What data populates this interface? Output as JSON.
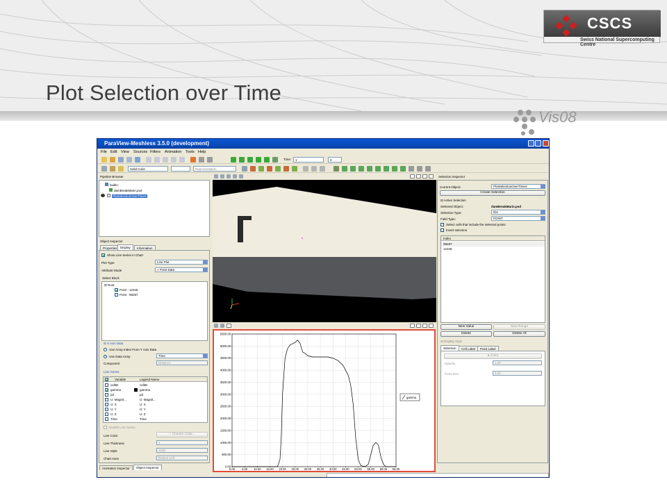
{
  "slide": {
    "title": "Plot Selection over Time",
    "logo_cscs": "CSCS",
    "logo_cscs_sub": "Swiss National Supercomputing Centre",
    "logo_vis": "Vis08"
  },
  "app": {
    "window_title": "ParaView-Meshless 3.5.0 (development)",
    "menu": [
      "File",
      "Edit",
      "View",
      "Sources",
      "Filters",
      "Animation",
      "Tools",
      "Help"
    ],
    "toolbar": {
      "time_label": "Time:",
      "time_value": "1",
      "time_index": "0",
      "color_by": "Solid Color",
      "representation": "Representation"
    },
    "pipeline_browser": {
      "title": "Pipeline Browser",
      "items": [
        "builtin:",
        "damBreakMarin.pvd",
        "PlotSelectionOverTimeX"
      ]
    },
    "object_inspector": {
      "title": "Object Inspector",
      "tabs": [
        "Properties",
        "Display",
        "Information"
      ],
      "show_line_series": "Show Line Series in Chart",
      "plot_type_label": "Plot Type",
      "plot_type_value": "Line Plot",
      "attribute_mode_label": "Attribute Mode",
      "attribute_mode_value": "Point Data",
      "select_block_label": "Select Block",
      "tree": [
        "Root",
        "Point : 12345",
        "Point : 98287"
      ],
      "x_axis_data": "X Axis Data",
      "use_array_index": "Use Array Index From Y Axis Data",
      "use_data_array": "Use Data Array",
      "data_array_value": "Time",
      "component_label": "Component",
      "component_value": "Distance",
      "line_series_label": "Line Series",
      "series_headers": [
        "Variable",
        "Legend Name"
      ],
      "series": [
        {
          "variable": "cellID",
          "legend": "cellID",
          "checked": false
        },
        {
          "variable": "gamma",
          "legend": "gamma",
          "checked": true
        },
        {
          "variable": "pd",
          "legend": "pd",
          "checked": false
        },
        {
          "variable": "U: Magnit...",
          "legend": "U: Magnit...",
          "checked": false
        },
        {
          "variable": "U: X",
          "legend": "U: X",
          "checked": false
        },
        {
          "variable": "U: Y",
          "legend": "U: Y",
          "checked": false
        },
        {
          "variable": "U: Z",
          "legend": "U: Z",
          "checked": false
        },
        {
          "variable": "Time",
          "legend": "Time",
          "checked": false
        }
      ],
      "enable_line_series": "Enable Line Series",
      "line_color_label": "Line Color",
      "choose_color": "Choose Color...",
      "line_thickness_label": "Line Thickness",
      "line_thickness_value": "1",
      "line_style_label": "Line Style",
      "line_style_value": "Solid",
      "chart_axes_label": "Chart Axes",
      "chart_axes_value": "Bottom-Left"
    },
    "bottom_tabs": [
      "Animation Inspector",
      "Object Inspector"
    ],
    "selection_inspector": {
      "title": "Selection Inspector",
      "current_object_label": "Current Object:",
      "current_object_value": "PlotSelectionOverTimeX",
      "create_selection": "Create Selection",
      "active_selection": "Active Selection",
      "selected_object_label": "Selected Object:",
      "selected_object_value": "damBreakMarin.pvd",
      "selection_type_label": "Selection Type:",
      "selection_type_value": "IDs",
      "field_type_label": "Field Type:",
      "field_type_value": "POINT",
      "select_cells": "Select cells that include the selected points",
      "invert_selection": "Invert selection",
      "index_header": "Index",
      "indices": [
        "98287",
        "12345"
      ],
      "new_value": "New Value",
      "new_range": "New Range",
      "delete": "Delete",
      "delete_all": "Delete All",
      "display_style": "Display Style",
      "style_tabs": [
        "Selection",
        "Cell Label",
        "Point Label"
      ],
      "color_label": "Color",
      "opacity_label": "Opacity",
      "opacity_value": "1.00",
      "point_size_label": "Point Size",
      "point_size_value": "5.00"
    }
  },
  "chart_data": {
    "type": "line",
    "title": "",
    "xlabel": "",
    "ylabel": "",
    "xlim": [
      0,
      65
    ],
    "ylim": [
      0,
      5500
    ],
    "xticks": [
      "0.00",
      "5.00",
      "10.00",
      "15.00",
      "20.00",
      "25.00",
      "30.00",
      "35.00",
      "40.00",
      "45.00",
      "50.00",
      "55.00",
      "60.00",
      "65.00"
    ],
    "yticks": [
      "0.00",
      "500.00",
      "1000.00",
      "1500.00",
      "2000.00",
      "2500.00",
      "3000.00",
      "3500.00",
      "4000.00",
      "4500.00",
      "5000.00",
      "5500.00"
    ],
    "grid": true,
    "legend_position": "right",
    "series": [
      {
        "name": "gamma",
        "color": "#000000",
        "x": [
          0,
          16,
          18,
          19,
          19.5,
          20,
          21,
          22,
          23,
          24,
          25,
          26,
          27,
          28,
          29,
          30,
          32,
          35,
          38,
          40,
          42,
          44,
          46,
          47,
          48,
          49,
          50,
          51,
          52,
          53,
          54,
          55,
          56,
          57,
          58,
          59,
          60,
          61,
          62,
          65
        ],
        "values": [
          0,
          0,
          0,
          300,
          1200,
          3000,
          4500,
          4900,
          5050,
          5100,
          5150,
          5250,
          5100,
          4750,
          4700,
          4600,
          4550,
          4550,
          4550,
          4500,
          4400,
          4200,
          3800,
          3400,
          2600,
          1200,
          300,
          50,
          20,
          20,
          100,
          500,
          900,
          1000,
          900,
          400,
          100,
          0,
          0,
          0
        ]
      }
    ]
  }
}
